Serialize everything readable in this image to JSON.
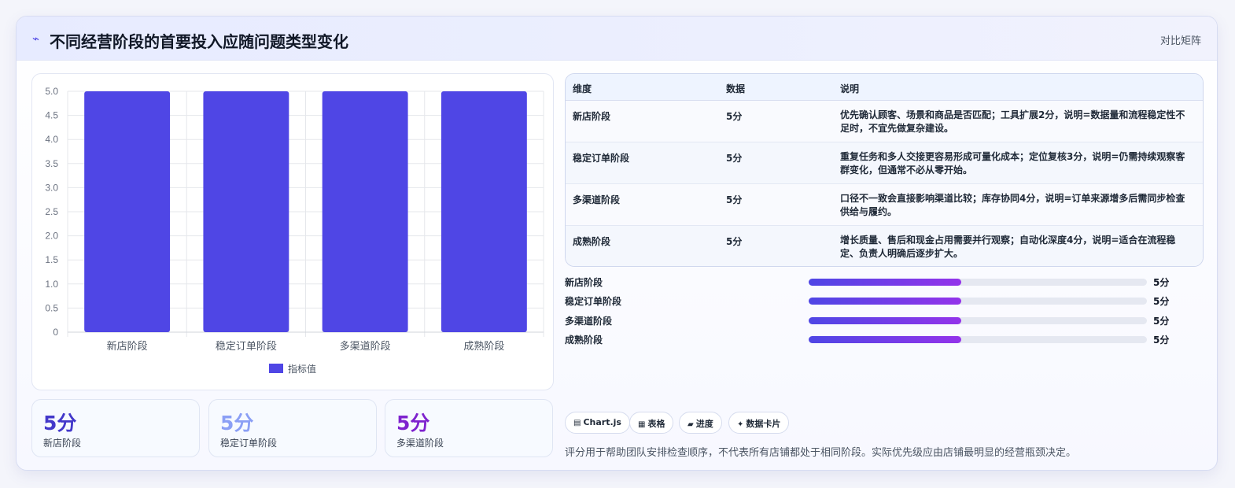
{
  "header": {
    "icon": "trend-icon",
    "icon_glyph": "⌁",
    "title": "不同经营阶段的首要投入应随问题类型变化",
    "tag": "对比矩阵"
  },
  "chart_data": {
    "type": "bar",
    "categories": [
      "新店阶段",
      "稳定订单阶段",
      "多渠道阶段",
      "成熟阶段"
    ],
    "series": [
      {
        "name": "指标值",
        "values": [
          5,
          5,
          5,
          5
        ],
        "color": "#4f46e5"
      }
    ],
    "ylim": [
      0,
      5
    ],
    "yticks": [
      "0",
      "0.5",
      "1.0",
      "1.5",
      "2.0",
      "2.5",
      "3.0",
      "3.5",
      "4.0",
      "4.5",
      "5.0"
    ],
    "grid": true,
    "legend": "bottom"
  },
  "stats": [
    {
      "value": "5分",
      "label": "新店阶段",
      "color": "#4338ca"
    },
    {
      "value": "5分",
      "label": "稳定订单阶段",
      "color": "#8b9ff5"
    },
    {
      "value": "5分",
      "label": "多渠道阶段",
      "color": "#7e22ce"
    }
  ],
  "table": {
    "headers": [
      "维度",
      "数据",
      "说明"
    ],
    "rows": [
      {
        "dim": "新店阶段",
        "data": "5分",
        "desc": "优先确认顾客、场景和商品是否匹配；工具扩展2分，说明=数据量和流程稳定性不足时，不宜先做复杂建设。"
      },
      {
        "dim": "稳定订单阶段",
        "data": "5分",
        "desc": "重复任务和多人交接更容易形成可量化成本；定位复核3分，说明=仍需持续观察客群变化，但通常不必从零开始。"
      },
      {
        "dim": "多渠道阶段",
        "data": "5分",
        "desc": "口径不一致会直接影响渠道比较；库存协同4分，说明=订单来源增多后需同步检查供给与履约。"
      },
      {
        "dim": "成熟阶段",
        "data": "5分",
        "desc": "增长质量、售后和现金占用需要并行观察；自动化深度4分，说明=适合在流程稳定、负责人明确后逐步扩大。"
      }
    ]
  },
  "progress": [
    {
      "label": "新店阶段",
      "value": "5分",
      "fraction": 0.45
    },
    {
      "label": "稳定订单阶段",
      "value": "5分",
      "fraction": 0.45
    },
    {
      "label": "多渠道阶段",
      "value": "5分",
      "fraction": 0.45
    },
    {
      "label": "成熟阶段",
      "value": "5分",
      "fraction": 0.45
    }
  ],
  "chips": [
    {
      "icon": "chart-icon",
      "glyph": "▤",
      "label": "Chart.js"
    },
    {
      "icon": "table-icon",
      "glyph": "▦",
      "label": "表格"
    },
    {
      "icon": "progress-icon",
      "glyph": "▰",
      "label": "进度"
    },
    {
      "icon": "card-icon",
      "glyph": "✦",
      "label": "数据卡片"
    }
  ],
  "footnote": "评分用于帮助团队安排检查顺序，不代表所有店铺都处于相同阶段。实际优先级应由店铺最明显的经营瓶颈决定。"
}
